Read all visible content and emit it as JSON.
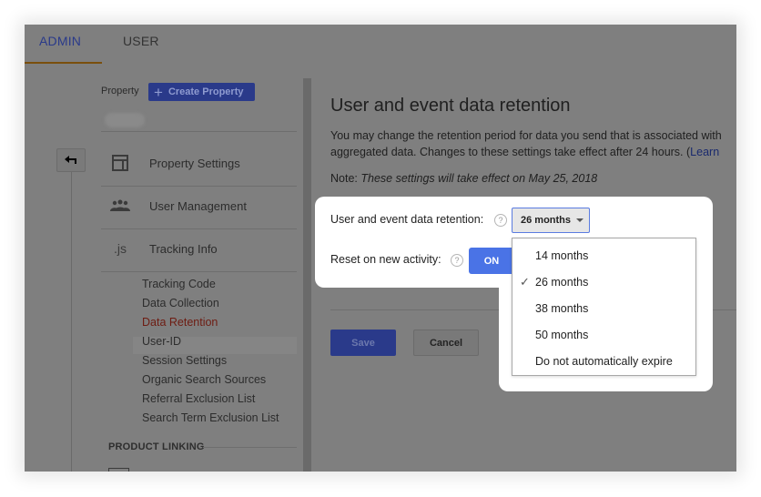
{
  "tabs": [
    {
      "label": "ADMIN",
      "active": true
    },
    {
      "label": "USER",
      "active": false
    }
  ],
  "colors": {
    "brand_blue": "#2a3a8a",
    "accent_blue": "#4a73e6",
    "active_link": "#6e1c12",
    "tab_underline": "#7a4f0c"
  },
  "sidebar": {
    "property_label": "Property",
    "create_property_label": "Create Property",
    "back_icon": "arrow-back-icon",
    "main_items": [
      {
        "label": "Property Settings",
        "icon": "property-settings-icon"
      },
      {
        "label": "User Management",
        "icon": "users-icon"
      },
      {
        "label": "Tracking Info",
        "icon": "js-icon",
        "icon_text": ".js"
      }
    ],
    "sub_items": [
      {
        "label": "Tracking Code",
        "active": false
      },
      {
        "label": "Data Collection",
        "active": false
      },
      {
        "label": "Data Retention",
        "active": true
      },
      {
        "label": "User-ID",
        "active": false
      },
      {
        "label": "Session Settings",
        "active": false
      },
      {
        "label": "Organic Search Sources",
        "active": false
      },
      {
        "label": "Referral Exclusion List",
        "active": false
      },
      {
        "label": "Search Term Exclusion List",
        "active": false
      }
    ],
    "section_header": "PRODUCT LINKING"
  },
  "main": {
    "title": "User and event data retention",
    "description_line1": "You may change the retention period for data you send that is associated with",
    "description_line2": "aggregated data. Changes to these settings take effect after 24 hours. (",
    "learn_link": "Learn",
    "note_prefix": "Note:",
    "note_text": "These settings will take effect on May 25, 2018",
    "retention_label": "User and event data retention:",
    "retention_value": "26 months",
    "reset_label": "Reset on new activity:",
    "reset_toggle": "ON",
    "help_glyph": "?",
    "save_label": "Save",
    "cancel_label": "Cancel"
  },
  "dropdown": {
    "options": [
      {
        "label": "14 months",
        "selected": false
      },
      {
        "label": "26 months",
        "selected": true
      },
      {
        "label": "38 months",
        "selected": false
      },
      {
        "label": "50 months",
        "selected": false
      },
      {
        "label": "Do not automatically expire",
        "selected": false
      }
    ],
    "check_glyph": "✓"
  }
}
